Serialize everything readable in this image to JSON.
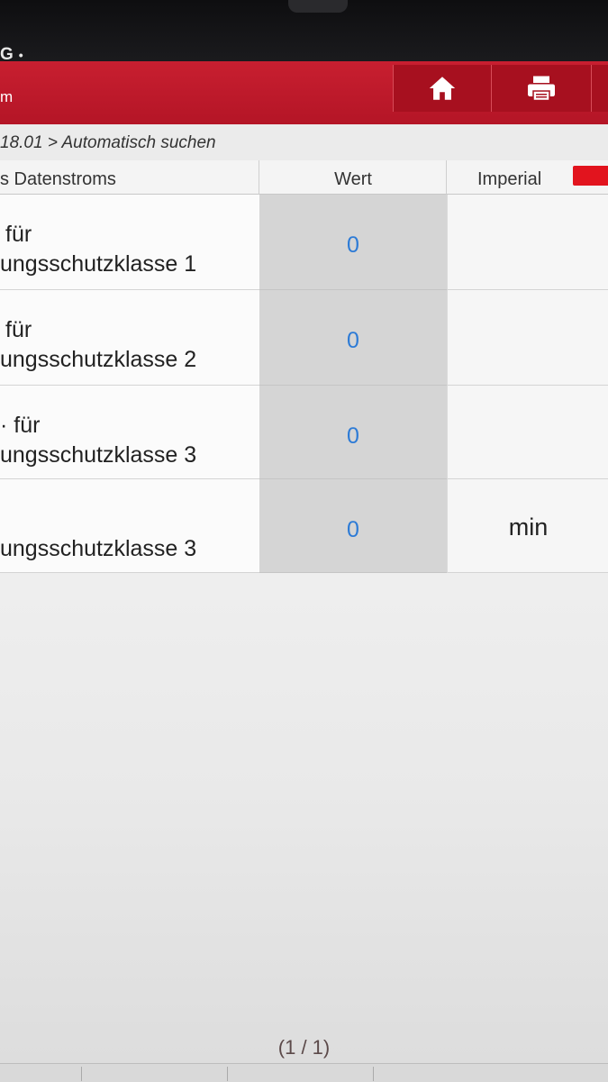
{
  "status_bar": {
    "text": "G",
    "dot": "•"
  },
  "title_bar": {
    "title_fragment": "m",
    "buttons": [
      {
        "name": "home-button",
        "icon": "home-icon"
      },
      {
        "name": "print-button",
        "icon": "printer-icon"
      }
    ],
    "accent": "#c81f30"
  },
  "breadcrumb": "18.01 > Automatisch suchen",
  "table": {
    "headers": {
      "name": "s Datenstroms",
      "value": "Wert",
      "unit": "Imperial"
    },
    "rows": [
      {
        "line1": "für",
        "line2": "ungsschutzklasse 1",
        "value": "0",
        "unit": ""
      },
      {
        "line1": "für",
        "line2": "ungsschutzklasse 2",
        "value": "0",
        "unit": ""
      },
      {
        "line1": "· für",
        "line2": "ungsschutzklasse 3",
        "value": "0",
        "unit": ""
      },
      {
        "line1": "",
        "line2": "ungsschutzklasse 3",
        "value": "0",
        "unit": "min"
      }
    ]
  },
  "pager": "(1 / 1)",
  "colors": {
    "value_text": "#2d7bd6",
    "unit_toggle": "#e2141e"
  }
}
